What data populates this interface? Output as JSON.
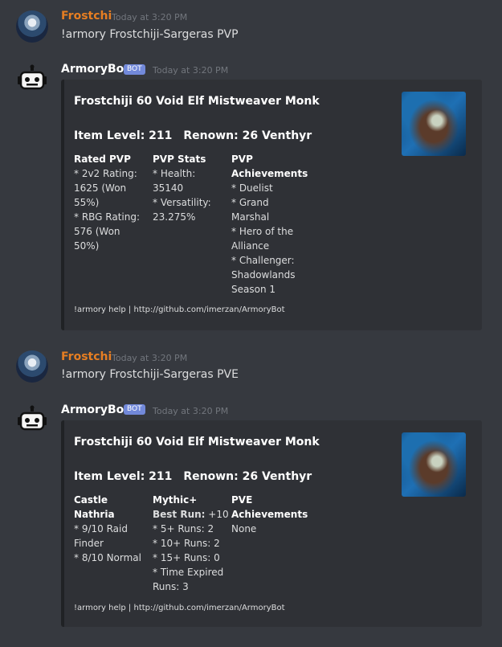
{
  "messages": [
    {
      "author": "Frostchi",
      "timestamp": "Today at 3:20 PM",
      "content": "!armory Frostchiji-Sargeras PVP"
    },
    {
      "author": "ArmoryBot",
      "badge": "BOT",
      "timestamp": "Today at 3:20 PM",
      "embed": {
        "title": "Frostchiji 60 Void Elf Mistweaver Monk",
        "item_level": "Item Level: 211",
        "renown": "Renown: 26 Venthyr",
        "fields": [
          {
            "name": "Rated PVP",
            "lines": [
              "* 2v2 Rating:",
              "1625 (Won",
              "55%)",
              "* RBG Rating:",
              "576 (Won",
              "50%)"
            ]
          },
          {
            "name": "PVP Stats",
            "lines": [
              "* Health:",
              "35140",
              "* Versatility:",
              "23.275%"
            ]
          },
          {
            "name": "PVP Achievements",
            "name_lines": [
              "PVP",
              "Achievements"
            ],
            "lines": [
              "* Duelist",
              "* Grand",
              "Marshal",
              "* Hero of the",
              "Alliance",
              "* Challenger:",
              "Shadowlands",
              "Season 1"
            ]
          }
        ],
        "footer": "!armory help | http://github.com/imerzan/ArmoryBot"
      }
    },
    {
      "author": "Frostchi",
      "timestamp": "Today at 3:20 PM",
      "content": "!armory Frostchiji-Sargeras PVE"
    },
    {
      "author": "ArmoryBot",
      "badge": "BOT",
      "timestamp": "Today at 3:20 PM",
      "embed": {
        "title": "Frostchiji 60 Void Elf Mistweaver Monk",
        "item_level": "Item Level: 211",
        "renown": "Renown: 26 Venthyr",
        "fields": [
          {
            "name": "Castle Nathria",
            "lines": [
              "* 9/10 Raid",
              "Finder",
              "* 8/10 Normal"
            ]
          },
          {
            "name": "Mythic+",
            "best_run_label": "Best Run:",
            "best_run_value": "+10",
            "lines": [
              "* 5+ Runs: 2",
              "* 10+ Runs: 2",
              "* 15+ Runs: 0",
              "* Time Expired",
              "Runs: 3"
            ]
          },
          {
            "name": "PVE Achievements",
            "name_lines": [
              "PVE",
              "Achievements"
            ],
            "lines": [
              "None"
            ]
          }
        ],
        "footer": "!armory help | http://github.com/imerzan/ArmoryBot"
      }
    }
  ],
  "colors": {
    "background": "#36393f",
    "embed_background": "#2f3136",
    "user_name": "#e67e22",
    "bot_badge": "#7289da",
    "timestamp": "#72767d"
  },
  "icons": {
    "bot_avatar": "robot-icon",
    "user_avatar": "user-avatar",
    "thumbnail": "character-thumbnail"
  }
}
